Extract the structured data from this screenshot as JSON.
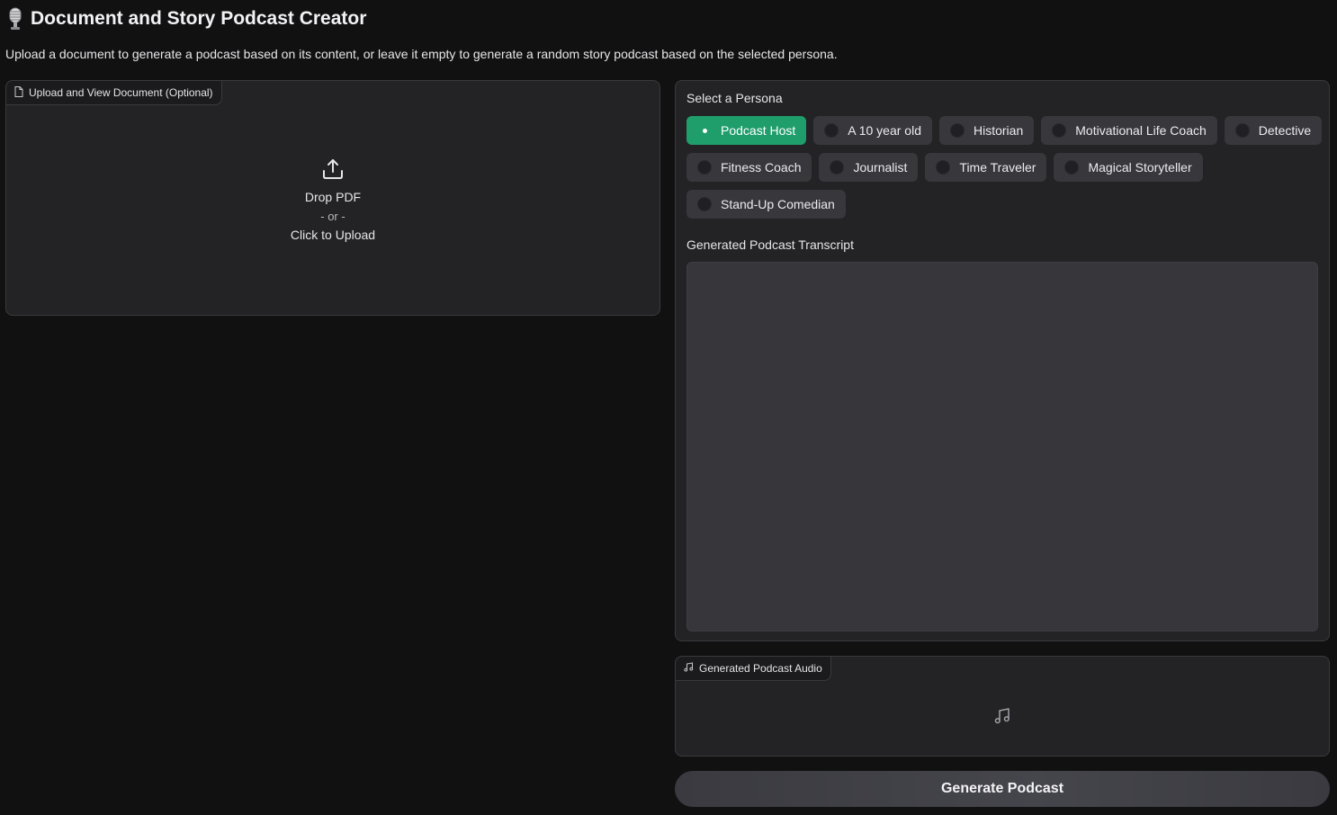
{
  "app": {
    "title": "Document and Story Podcast Creator",
    "title_icon": "microphone-icon",
    "description": "Upload a document to generate a podcast based on its content, or leave it empty to generate a random story podcast based on the selected persona."
  },
  "upload": {
    "label": "Upload and View Document (Optional)",
    "label_icon": "file-icon",
    "drop_text": "Drop PDF",
    "or_text": "- or -",
    "click_text": "Click to Upload",
    "icon": "upload-icon"
  },
  "persona": {
    "label": "Select a Persona",
    "selected": "Podcast Host",
    "options": [
      {
        "label": "Podcast Host",
        "selected": true
      },
      {
        "label": "A 10 year old",
        "selected": false
      },
      {
        "label": "Historian",
        "selected": false
      },
      {
        "label": "Motivational Life Coach",
        "selected": false
      },
      {
        "label": "Detective",
        "selected": false
      },
      {
        "label": "Fitness Coach",
        "selected": false
      },
      {
        "label": "Journalist",
        "selected": false
      },
      {
        "label": "Time Traveler",
        "selected": false
      },
      {
        "label": "Magical Storyteller",
        "selected": false
      },
      {
        "label": "Stand-Up Comedian",
        "selected": false
      }
    ]
  },
  "transcript": {
    "label": "Generated Podcast Transcript",
    "value": ""
  },
  "audio": {
    "label": "Generated Podcast Audio",
    "label_icon": "music-note-icon",
    "placeholder_icon": "music-note-icon"
  },
  "actions": {
    "generate_label": "Generate Podcast"
  },
  "colors": {
    "background": "#111112",
    "panel": "#232326",
    "accent": "#1f9e6c",
    "radio_option": "#37373c"
  }
}
